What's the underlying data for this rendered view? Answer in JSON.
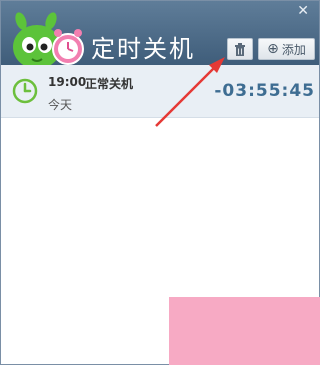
{
  "window": {
    "title": "定时关机",
    "close_glyph": "✕"
  },
  "toolbar": {
    "delete_icon": "trash-icon",
    "add_icon": "plus-circle-icon",
    "add_label": "添加",
    "add_glyph": "⊕"
  },
  "tasks": [
    {
      "time": "19:00",
      "action": "正常关机",
      "day": "今天",
      "countdown": "-03:55:45"
    }
  ],
  "colors": {
    "header": "#4f6e8c",
    "row_background": "#e9eff5",
    "clock_icon": "#6cbf3c",
    "countdown": "#3e6d92",
    "annotation_arrow": "#e53935",
    "overlay_block": "#f7aac4"
  }
}
